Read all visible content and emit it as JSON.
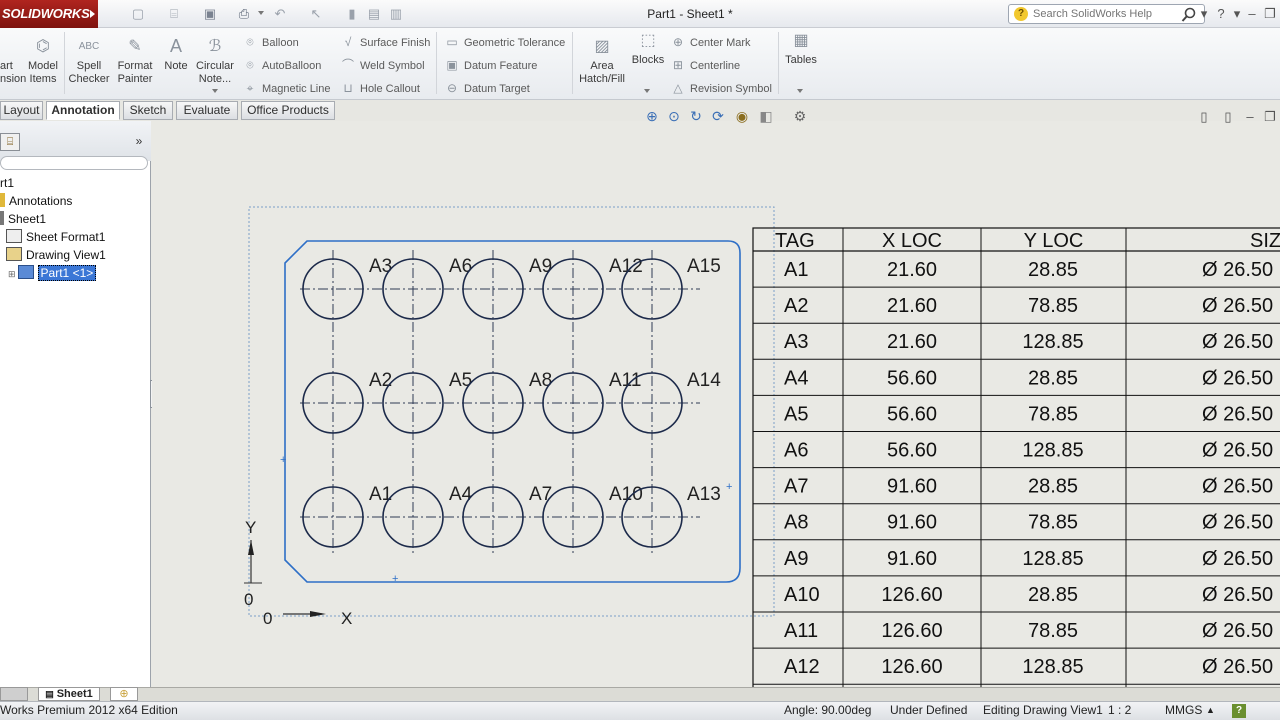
{
  "app": {
    "logo": "SOLIDWORKS",
    "doc_title": "Part1 - Sheet1 *"
  },
  "search": {
    "placeholder": "Search SolidWorks Help"
  },
  "ribbon": {
    "big_buttons": [
      {
        "name": "smart-dimension",
        "label": "art\nnsion",
        "icon": "dimension-icon"
      },
      {
        "name": "model-items",
        "label": "Model\nItems",
        "icon": "model-items-icon"
      },
      {
        "name": "spell-checker",
        "label": "Spell\nChecker",
        "icon": "spell-check-icon"
      },
      {
        "name": "format-painter",
        "label": "Format\nPainter",
        "icon": "brush-icon"
      },
      {
        "name": "note",
        "label": "Note",
        "icon": "note-icon"
      },
      {
        "name": "circular-note",
        "label": "Circular\nNote...",
        "icon": "circular-note-icon"
      }
    ],
    "col1": [
      "Balloon",
      "AutoBalloon",
      "Magnetic Line"
    ],
    "col2": [
      "Surface Finish",
      "Weld Symbol",
      "Hole Callout"
    ],
    "col3": [
      "Geometric Tolerance",
      "Datum Feature",
      "Datum Target"
    ],
    "area_hatch": "Area\nHatch/Fill",
    "blocks": "Blocks",
    "col4": [
      "Center Mark",
      "Centerline",
      "Revision Symbol"
    ],
    "tables": "Tables"
  },
  "tabs": [
    "Layout",
    "Annotation",
    "Sketch",
    "Evaluate",
    "Office Products"
  ],
  "active_tab": "Annotation",
  "tree": {
    "items": [
      {
        "label": "rt1",
        "icon": "part-icon"
      },
      {
        "label": "Annotations",
        "icon": "annotations-folder-icon"
      },
      {
        "label": "Sheet1",
        "icon": "sheet-icon"
      },
      {
        "label": "Sheet Format1",
        "icon": "sheet-format-icon"
      },
      {
        "label": "Drawing View1",
        "icon": "drawing-view-icon"
      },
      {
        "label": "Part1 <1>",
        "icon": "part-instance-icon",
        "selected": true
      }
    ]
  },
  "drawing": {
    "holes": [
      {
        "tag": "A1",
        "x": "21.60",
        "y": "28.85",
        "size": "Ø 26.50"
      },
      {
        "tag": "A2",
        "x": "21.60",
        "y": "78.85",
        "size": "Ø 26.50"
      },
      {
        "tag": "A3",
        "x": "21.60",
        "y": "128.85",
        "size": "Ø 26.50"
      },
      {
        "tag": "A4",
        "x": "56.60",
        "y": "28.85",
        "size": "Ø 26.50"
      },
      {
        "tag": "A5",
        "x": "56.60",
        "y": "78.85",
        "size": "Ø 26.50"
      },
      {
        "tag": "A6",
        "x": "56.60",
        "y": "128.85",
        "size": "Ø 26.50"
      },
      {
        "tag": "A7",
        "x": "91.60",
        "y": "28.85",
        "size": "Ø 26.50"
      },
      {
        "tag": "A8",
        "x": "91.60",
        "y": "78.85",
        "size": "Ø 26.50"
      },
      {
        "tag": "A9",
        "x": "91.60",
        "y": "128.85",
        "size": "Ø 26.50"
      },
      {
        "tag": "A10",
        "x": "126.60",
        "y": "28.85",
        "size": "Ø 26.50"
      },
      {
        "tag": "A11",
        "x": "126.60",
        "y": "78.85",
        "size": "Ø 26.50"
      },
      {
        "tag": "A12",
        "x": "126.60",
        "y": "128.85",
        "size": "Ø 26.50"
      }
    ],
    "extra_hole_tags": [
      "A13",
      "A14",
      "A15"
    ],
    "table_headers": [
      "TAG",
      "X LOC",
      "Y LOC",
      "SIZE"
    ],
    "origin": {
      "x_label": "X",
      "y_label": "Y",
      "x_zero": "0",
      "y_zero": "0"
    }
  },
  "sheet_tab": "Sheet1",
  "status": {
    "edition": "Works Premium 2012 x64 Edition",
    "angle": "Angle: 90.00deg",
    "defined": "Under Defined",
    "editing": "Editing Drawing View1",
    "scale": "1 : 2",
    "units": "MMGS"
  }
}
